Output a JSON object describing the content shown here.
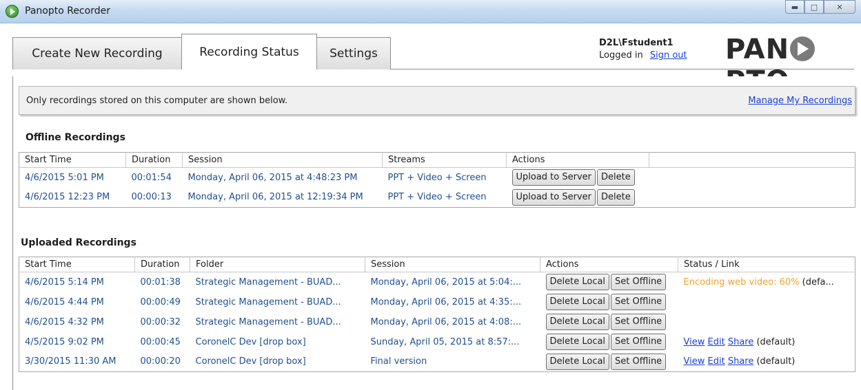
{
  "window": {
    "title": "Panopto Recorder"
  },
  "tabs": [
    {
      "label": "Create New Recording"
    },
    {
      "label": "Recording Status"
    },
    {
      "label": "Settings"
    }
  ],
  "user": {
    "name": "D2L\\Fstudent1",
    "logged_in": "Logged in",
    "sign_out": "Sign out"
  },
  "logo": {
    "text_left": "PAN",
    "text_right": "PTO"
  },
  "notice": {
    "text": "Only recordings stored on this computer are shown below.",
    "link": "Manage My Recordings"
  },
  "offline": {
    "title": "Offline Recordings",
    "columns": [
      "Start Time",
      "Duration",
      "Session",
      "Streams",
      "Actions",
      ""
    ],
    "rows": [
      {
        "start": "4/6/2015 5:01 PM",
        "duration": "00:01:54",
        "session": "Monday, April 06, 2015 at 4:48:23 PM",
        "streams": "PPT + Video + Screen",
        "upload": "Upload to Server",
        "delete": "Delete"
      },
      {
        "start": "4/6/2015 12:23 PM",
        "duration": "00:00:13",
        "session": "Monday, April 06, 2015 at 12:19:34 PM",
        "streams": "PPT + Video + Screen",
        "upload": "Upload to Server",
        "delete": "Delete"
      }
    ]
  },
  "uploaded": {
    "title": "Uploaded Recordings",
    "columns": [
      "Start Time",
      "Duration",
      "Folder",
      "Session",
      "Actions",
      "Status / Link"
    ],
    "rows": [
      {
        "start": "4/6/2015 5:14 PM",
        "duration": "00:01:38",
        "folder": "Strategic Management - BUAD...",
        "session": "Monday, April 06, 2015 at 5:04:...",
        "delete_local": "Delete Local",
        "set_offline": "Set Offline",
        "status": "Encoding web video: 60%",
        "status_suffix": "(defa...",
        "view": "",
        "edit": "",
        "share": "",
        "default": ""
      },
      {
        "start": "4/6/2015 4:44 PM",
        "duration": "00:00:49",
        "folder": "Strategic Management - BUAD...",
        "session": "Monday, April 06, 2015 at 4:35:...",
        "delete_local": "Delete Local",
        "set_offline": "Set Offline",
        "status": "",
        "status_suffix": "",
        "view": "",
        "edit": "",
        "share": "",
        "default": ""
      },
      {
        "start": "4/6/2015 4:32 PM",
        "duration": "00:00:32",
        "folder": "Strategic Management - BUAD...",
        "session": "Monday, April 06, 2015 at 4:08:...",
        "delete_local": "Delete Local",
        "set_offline": "Set Offline",
        "status": "",
        "status_suffix": "",
        "view": "",
        "edit": "",
        "share": "",
        "default": ""
      },
      {
        "start": "4/5/2015 9:02 PM",
        "duration": "00:00:45",
        "folder": "CoronelC Dev [drop box]",
        "session": "Sunday, April 05, 2015 at 8:57:...",
        "delete_local": "Delete Local",
        "set_offline": "Set Offline",
        "status": "",
        "status_suffix": "",
        "view": "View",
        "edit": "Edit",
        "share": "Share",
        "default": "(default)"
      },
      {
        "start": "3/30/2015 11:30 AM",
        "duration": "00:00:20",
        "folder": "CoronelC Dev [drop box]",
        "session": "Final version",
        "delete_local": "Delete Local",
        "set_offline": "Set Offline",
        "status": "",
        "status_suffix": "",
        "view": "View",
        "edit": "Edit",
        "share": "Share",
        "default": "(default)"
      }
    ]
  },
  "colors": {
    "link": "#1a3fd6",
    "encoding": "#f0a32a",
    "cell_text": "#1f4f8f"
  },
  "icons": {
    "app": "panopto-play-icon",
    "minimize": "minimize-icon",
    "maximize": "maximize-icon",
    "close": "close-icon"
  }
}
